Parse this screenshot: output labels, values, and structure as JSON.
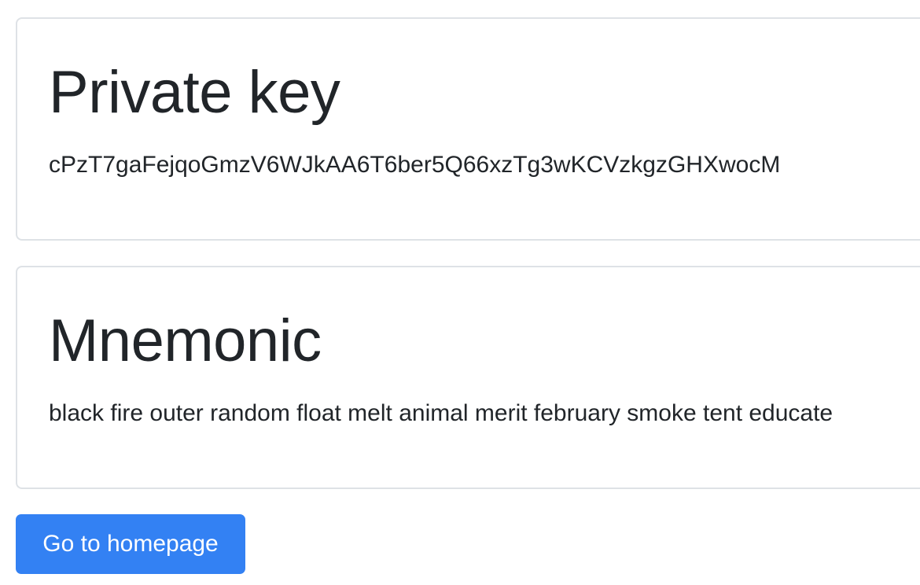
{
  "private_key": {
    "heading": "Private key",
    "value": "cPzT7gaFejqoGmzV6WJkAA6T6ber5Q66xzTg3wKCVzkgzGHXwocM"
  },
  "mnemonic": {
    "heading": "Mnemonic",
    "value": "black fire outer random float melt animal merit february smoke tent educate"
  },
  "actions": {
    "homepage_label": "Go to homepage"
  },
  "colors": {
    "primary_button": "#3381f3",
    "card_border": "#dee2e6",
    "text": "#212529"
  }
}
